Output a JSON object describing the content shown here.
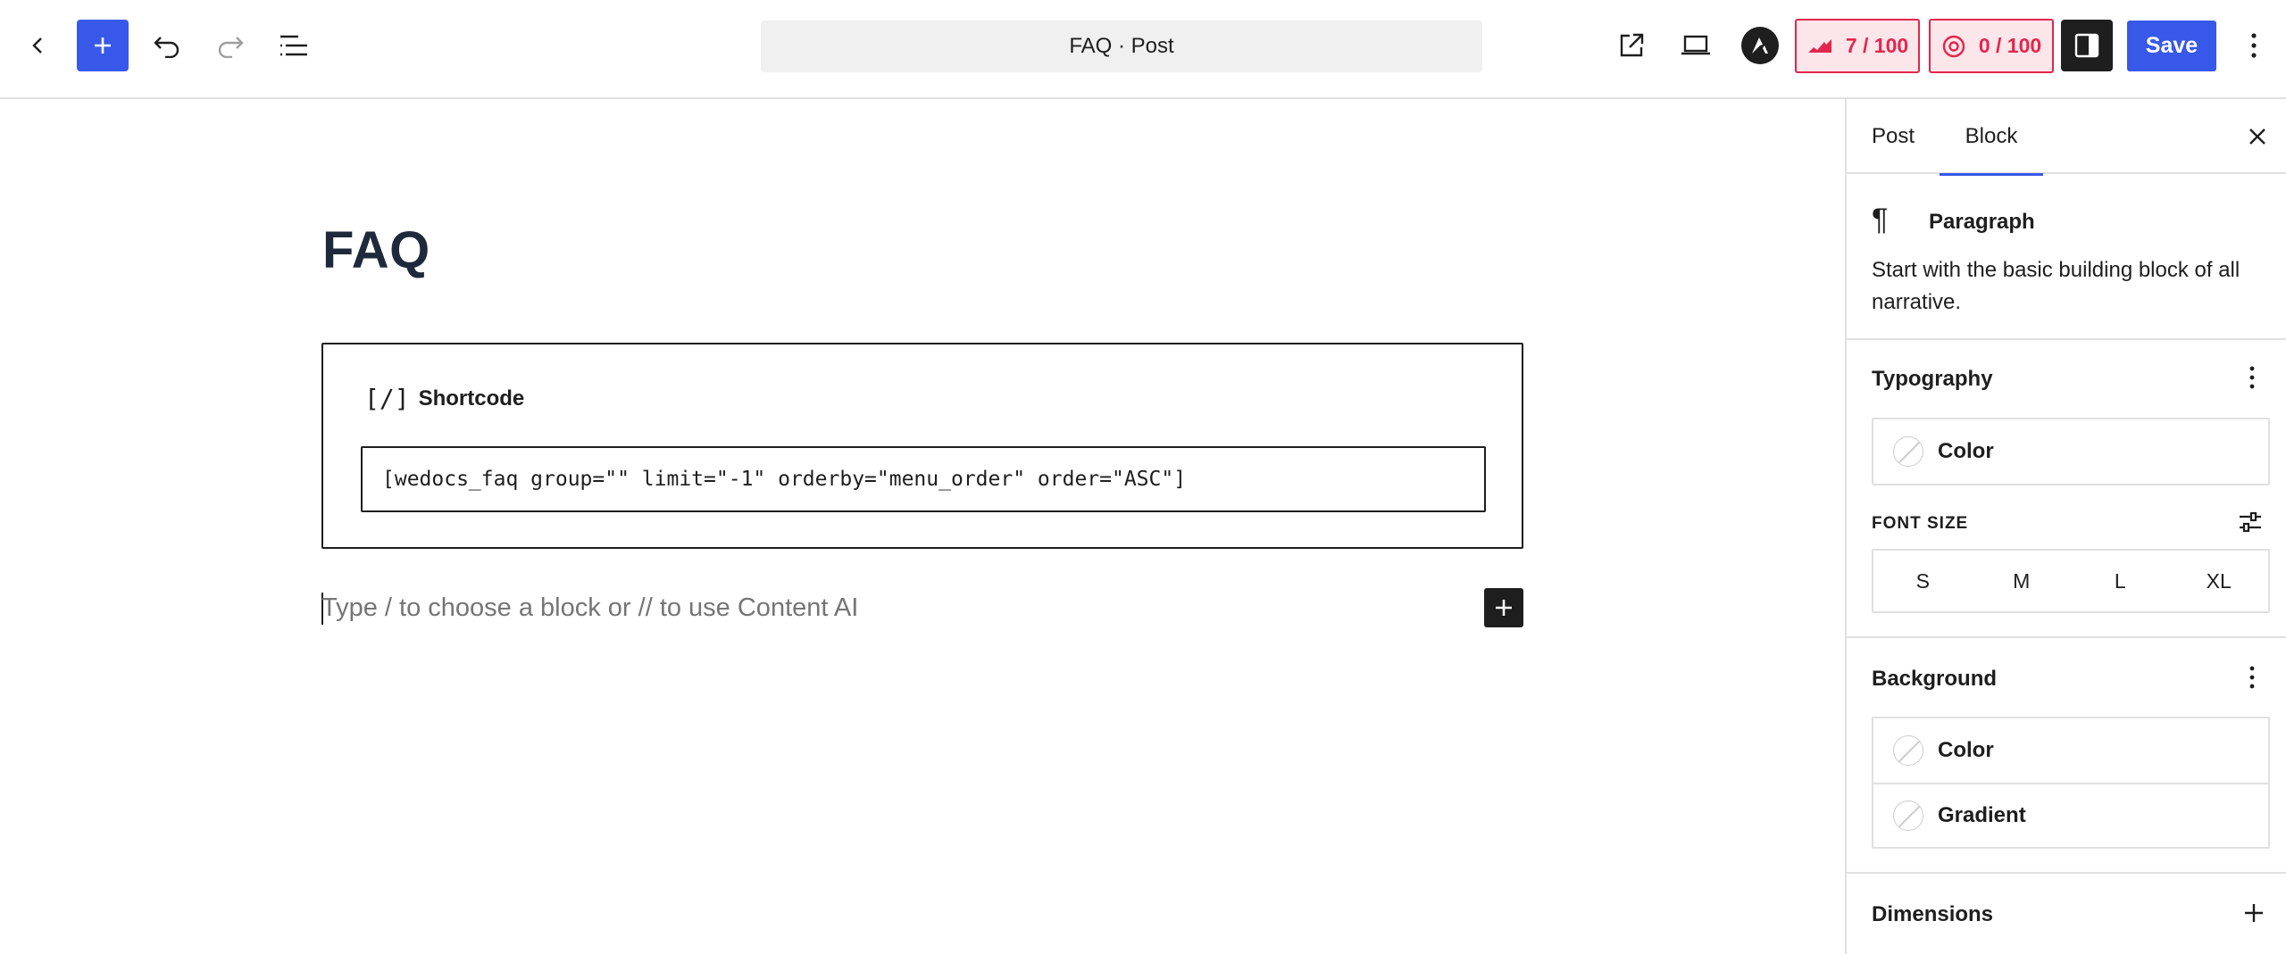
{
  "topbar": {
    "document_title": "FAQ · Post",
    "seo_score": "7 / 100",
    "readability_score": "0 / 100",
    "save_label": "Save"
  },
  "editor": {
    "post_title": "FAQ",
    "shortcode_block": {
      "icon_glyph": "[/]",
      "label": "Shortcode",
      "value": "[wedocs_faq group=\"\" limit=\"-1\" orderby=\"menu_order\" order=\"ASC\"]"
    },
    "empty_paragraph_placeholder": "Type / to choose a block or // to use Content AI"
  },
  "sidebar": {
    "tabs": [
      {
        "label": "Post",
        "active": false
      },
      {
        "label": "Block",
        "active": true
      }
    ],
    "block_card": {
      "icon_glyph": "¶",
      "title": "Paragraph",
      "description": "Start with the basic building block of all narrative."
    },
    "typography": {
      "title": "Typography",
      "color_label": "Color",
      "font_size_label": "FONT SIZE",
      "font_sizes": [
        "S",
        "M",
        "L",
        "XL"
      ]
    },
    "background": {
      "title": "Background",
      "color_label": "Color",
      "gradient_label": "Gradient"
    },
    "dimensions": {
      "title": "Dimensions"
    }
  },
  "colors": {
    "accent": "#3858e9",
    "score_red": "#e2264d",
    "score_bg": "#fde6ea",
    "dark": "#1e1e1e"
  },
  "icons": [
    "chevron-left-icon",
    "plus-icon",
    "undo-icon",
    "redo-icon",
    "list-view-icon",
    "external-link-icon",
    "desktop-preview-icon",
    "astra-logo-icon",
    "rank-math-icon",
    "content-ai-icon",
    "sidebar-toggle-icon",
    "more-vertical-icon",
    "close-icon",
    "paragraph-icon",
    "sliders-icon"
  ]
}
